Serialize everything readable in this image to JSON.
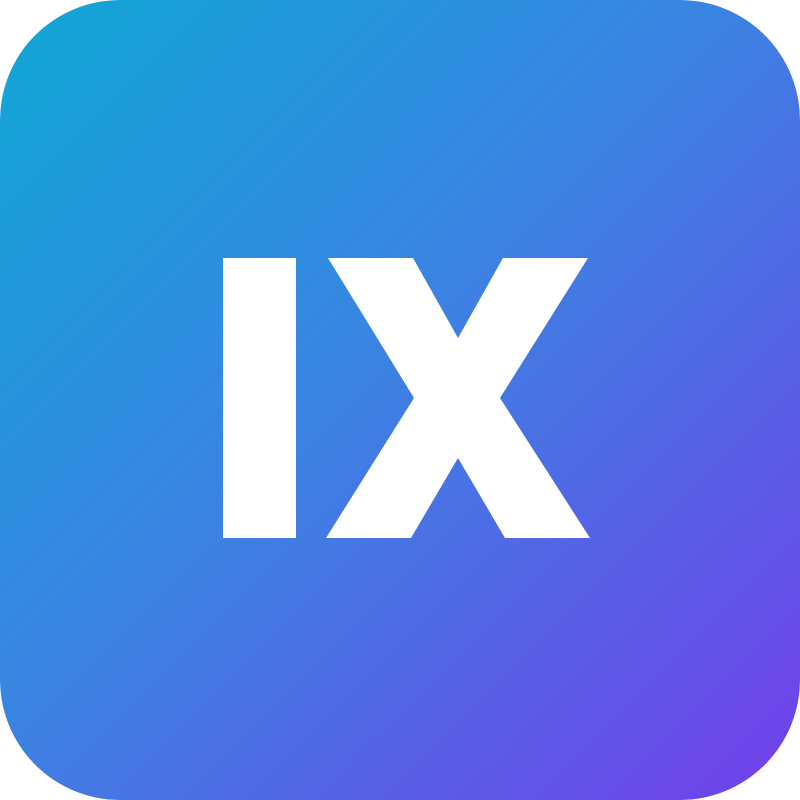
{
  "icon": {
    "name": "ix-app-icon",
    "label": "IX",
    "glyph_color": "#ffffff"
  },
  "colors": {
    "gradient_start": "#0fa8d6",
    "gradient_mid": "#3a84e2",
    "gradient_end": "#733eea"
  }
}
